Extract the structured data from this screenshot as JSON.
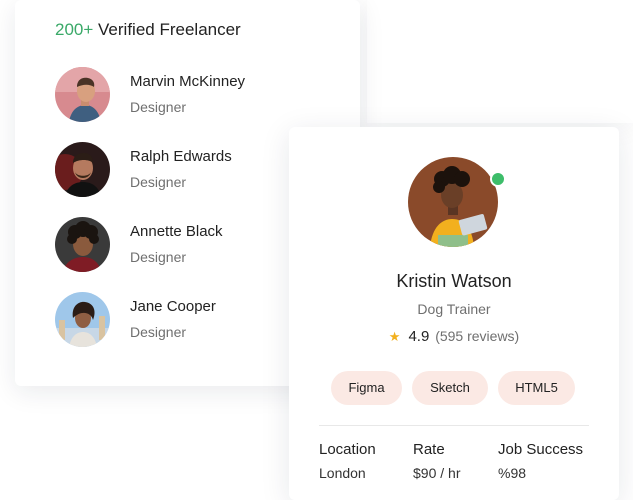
{
  "freelancers": {
    "title_count": "200+",
    "title_text": "Verified Freelancer",
    "items": [
      {
        "name": "Marvin McKinney",
        "role": "Designer"
      },
      {
        "name": "Ralph Edwards",
        "role": "Designer"
      },
      {
        "name": "Annette Black",
        "role": "Designer"
      },
      {
        "name": "Jane Cooper",
        "role": "Designer"
      }
    ]
  },
  "profile": {
    "name": "Kristin Watson",
    "role": "Dog Trainer",
    "status": "online",
    "rating": "4.9",
    "reviews": "(595 reviews)",
    "skills": [
      "Figma",
      "Sketch",
      "HTML5"
    ],
    "stats": [
      {
        "label": "Location",
        "value": "London"
      },
      {
        "label": "Rate",
        "value": "$90 / hr"
      },
      {
        "label": "Job Success",
        "value": "%98"
      }
    ]
  },
  "colors": {
    "accent_green": "#3aa968",
    "online_dot": "#3dbd6a",
    "star": "#f2b01e",
    "skill_bg": "#fbe9e4"
  },
  "icons": {
    "star": "star-icon",
    "online": "online-status-icon"
  }
}
